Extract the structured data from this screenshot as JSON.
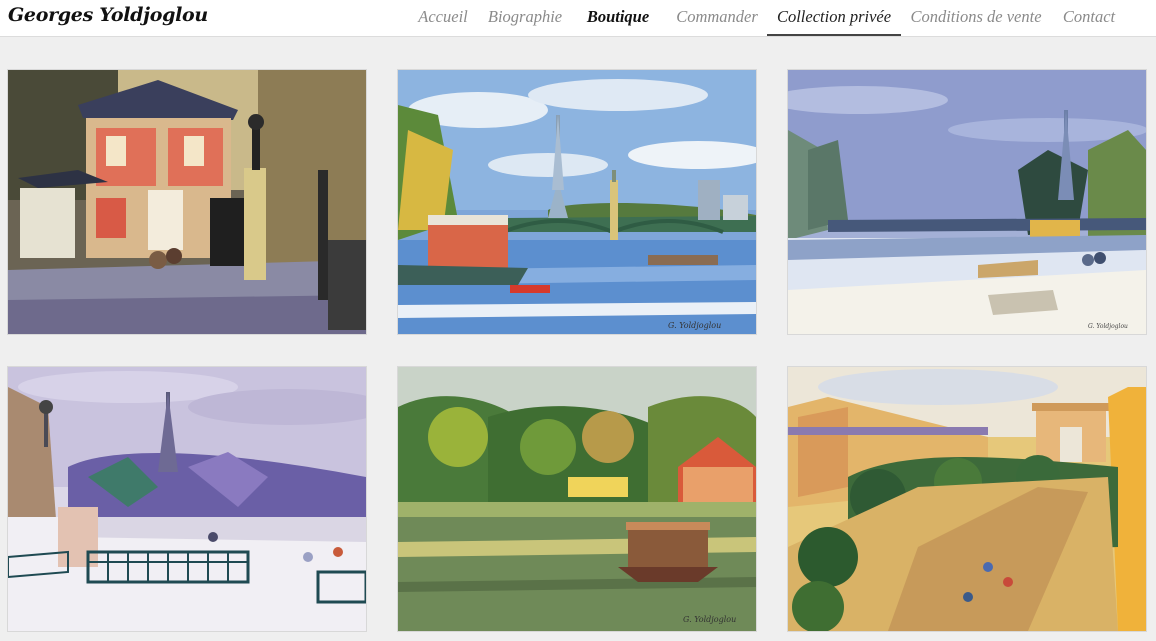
{
  "header": {
    "logo": "Georges Yoldjoglou"
  },
  "nav": {
    "items": [
      {
        "label": "Accueil",
        "state": "normal"
      },
      {
        "label": "Biographie",
        "state": "normal"
      },
      {
        "label": "Boutique",
        "state": "active"
      },
      {
        "label": "Commander",
        "state": "normal"
      },
      {
        "label": "Collection privée",
        "state": "current"
      },
      {
        "label": "Conditions de vente",
        "state": "normal"
      },
      {
        "label": "Contact",
        "state": "normal"
      }
    ]
  },
  "gallery": {
    "paintings": [
      {
        "id": "pavilion",
        "subject": "Pink pavilion with iron gate under autumn trees"
      },
      {
        "id": "seine-statue",
        "subject": "Seine with Eiffel Tower, Statue of Liberty and bridge"
      },
      {
        "id": "seine-snow",
        "subject": "Snowy Seine quay with Eiffel Tower and bridge"
      },
      {
        "id": "trocadero-snow",
        "subject": "Snowy garden with Eiffel Tower and iron railings"
      },
      {
        "id": "bois-boulogne",
        "subject": "Lake with chalet and boat among trees"
      },
      {
        "id": "champs-elysees",
        "subject": "Champs-Élysées avenue with Arc de Triomphe"
      }
    ]
  }
}
